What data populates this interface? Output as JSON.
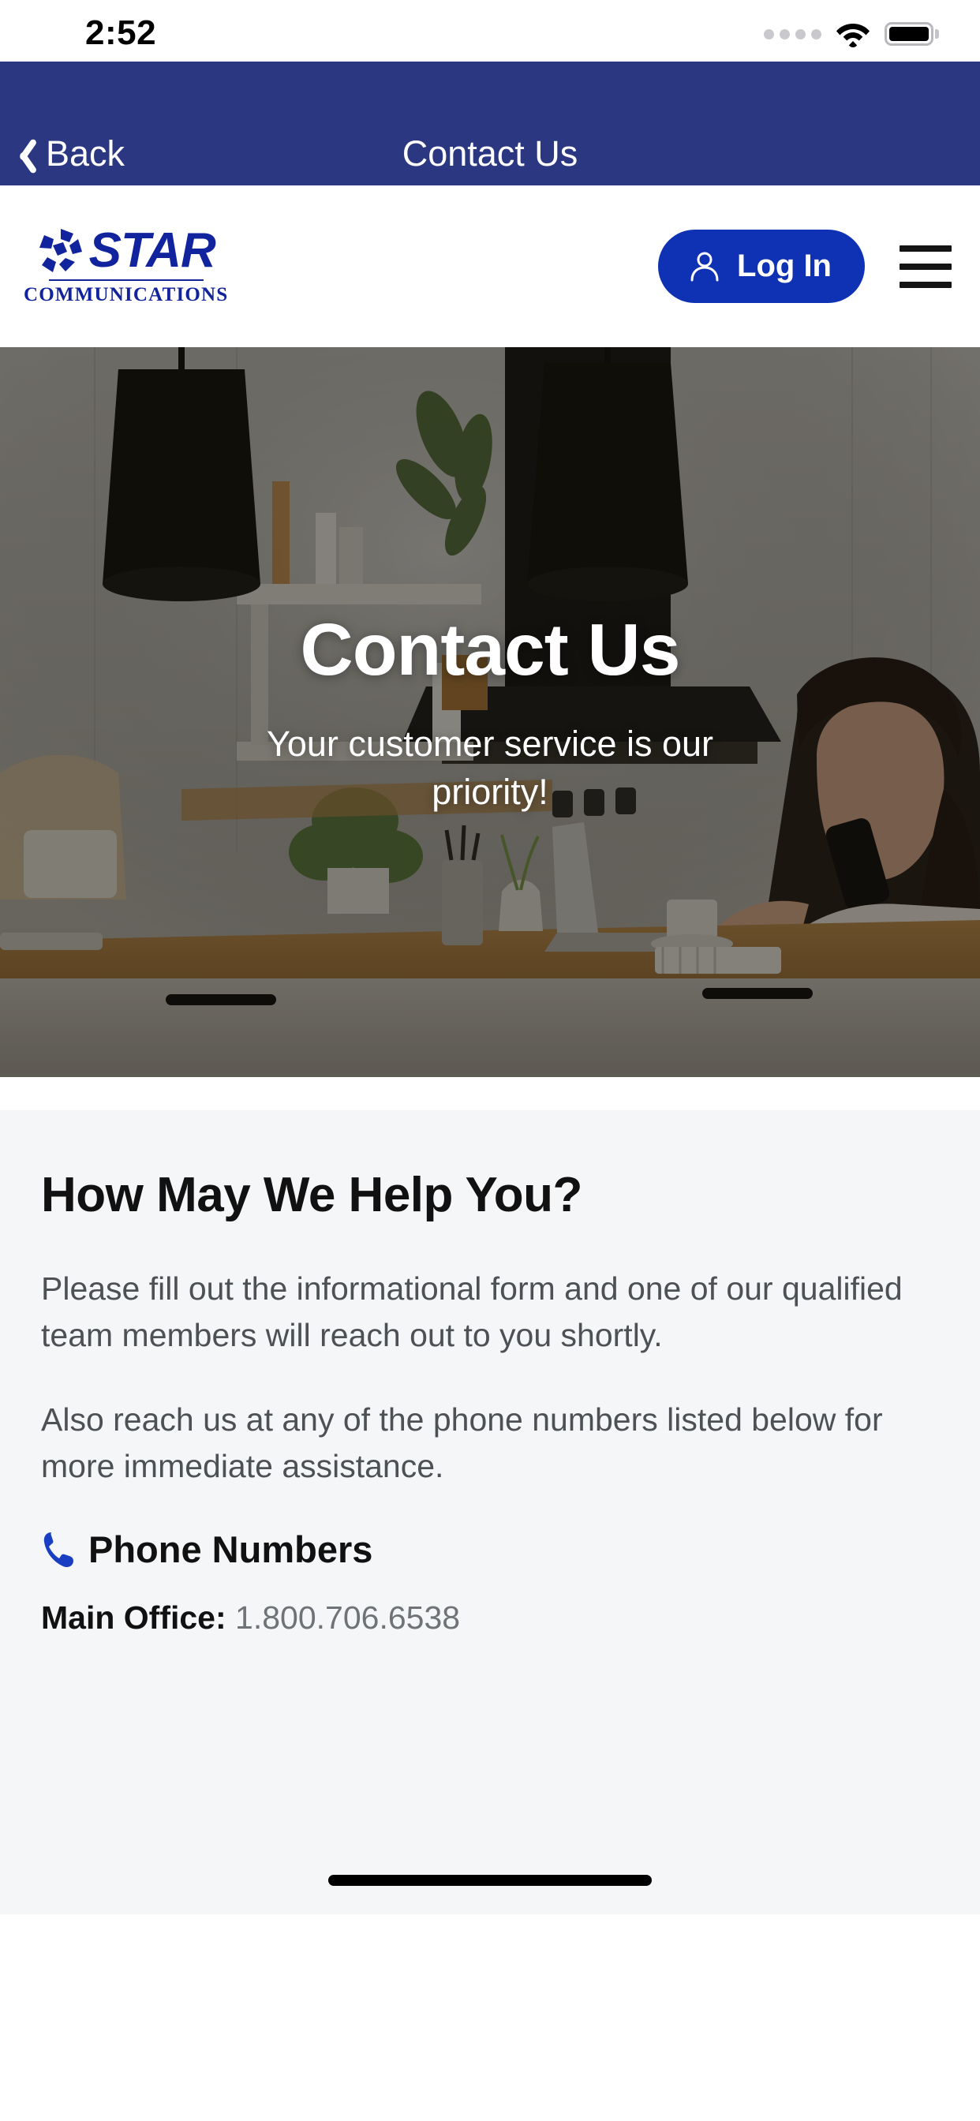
{
  "status_bar": {
    "time": "2:52",
    "signal_icon": "signal-dots-icon",
    "wifi_icon": "wifi-icon",
    "battery_icon": "battery-full-icon"
  },
  "nav": {
    "back_label": "Back",
    "back_icon": "chevron-left-icon",
    "title": "Contact Us"
  },
  "header": {
    "logo_mark_icon": "star-pinwheel-icon",
    "logo_wordmark": "STAR",
    "logo_subtitle": "COMMUNICATIONS",
    "login_label": "Log In",
    "login_icon": "user-icon",
    "menu_icon": "hamburger-menu-icon",
    "brand_blue": "#12239e",
    "login_blue": "#0f32b4"
  },
  "hero": {
    "title": "Contact Us",
    "subtitle": "Your customer service is our priority!",
    "image_alt": "woman-on-phone-in-kitchen"
  },
  "main": {
    "section_title": "How May We Help You?",
    "paragraph_1": "Please fill out the informational form and one of our qualified team members will reach out to you shortly.",
    "paragraph_2": "Also reach us at any of the phone numbers listed below for more immediate assistance.",
    "phone_heading": "Phone Numbers",
    "phone_heading_icon": "telephone-receiver-icon",
    "phone_numbers": [
      {
        "label": "Main Office:",
        "number": "1.800.706.6538"
      }
    ]
  },
  "colors": {
    "nav_bar": "#2b3780",
    "content_bg": "#f5f6f8",
    "body_text": "#4d5054"
  }
}
